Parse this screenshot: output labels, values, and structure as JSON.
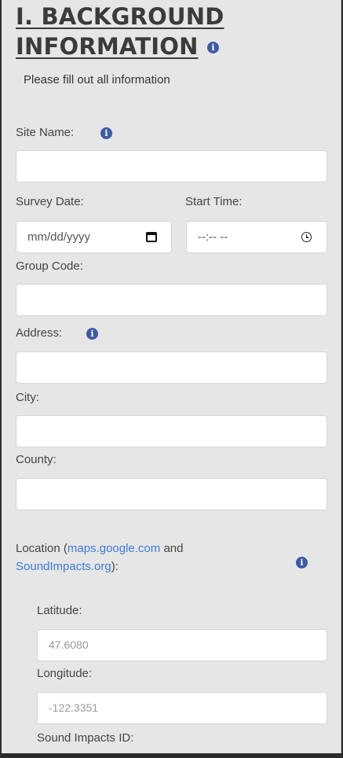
{
  "section": {
    "title_line1": "I. BACKGROUND",
    "title_line2": "INFORMATION",
    "instruction": "Please fill out all information"
  },
  "fields": {
    "site_name_label": "Site Name:",
    "survey_date_label": "Survey Date:",
    "survey_date_placeholder": "mm/dd/yyyy",
    "start_time_label": "Start Time:",
    "start_time_placeholder": "--:-- --",
    "group_code_label": "Group Code:",
    "address_label": "Address:",
    "city_label": "City:",
    "county_label": "County:",
    "location": {
      "prefix": "Location (",
      "link1": "maps.google.com",
      "middle": " and",
      "link2": "SoundImpacts.org",
      "suffix": "):"
    },
    "latitude_label": "Latitude:",
    "latitude_value": "47.6080",
    "longitude_label": "Longitude:",
    "longitude_value": "-122.3351",
    "sound_impacts_id_label": "Sound Impacts ID:"
  },
  "icons": {
    "info": "info-circle-icon",
    "calendar": "calendar-icon",
    "clock": "clock-icon",
    "info_glyph": "i"
  },
  "colors": {
    "info_icon": "#3d5aa6",
    "link": "#3b7dd8",
    "panel_bg": "#e6e6e6"
  }
}
